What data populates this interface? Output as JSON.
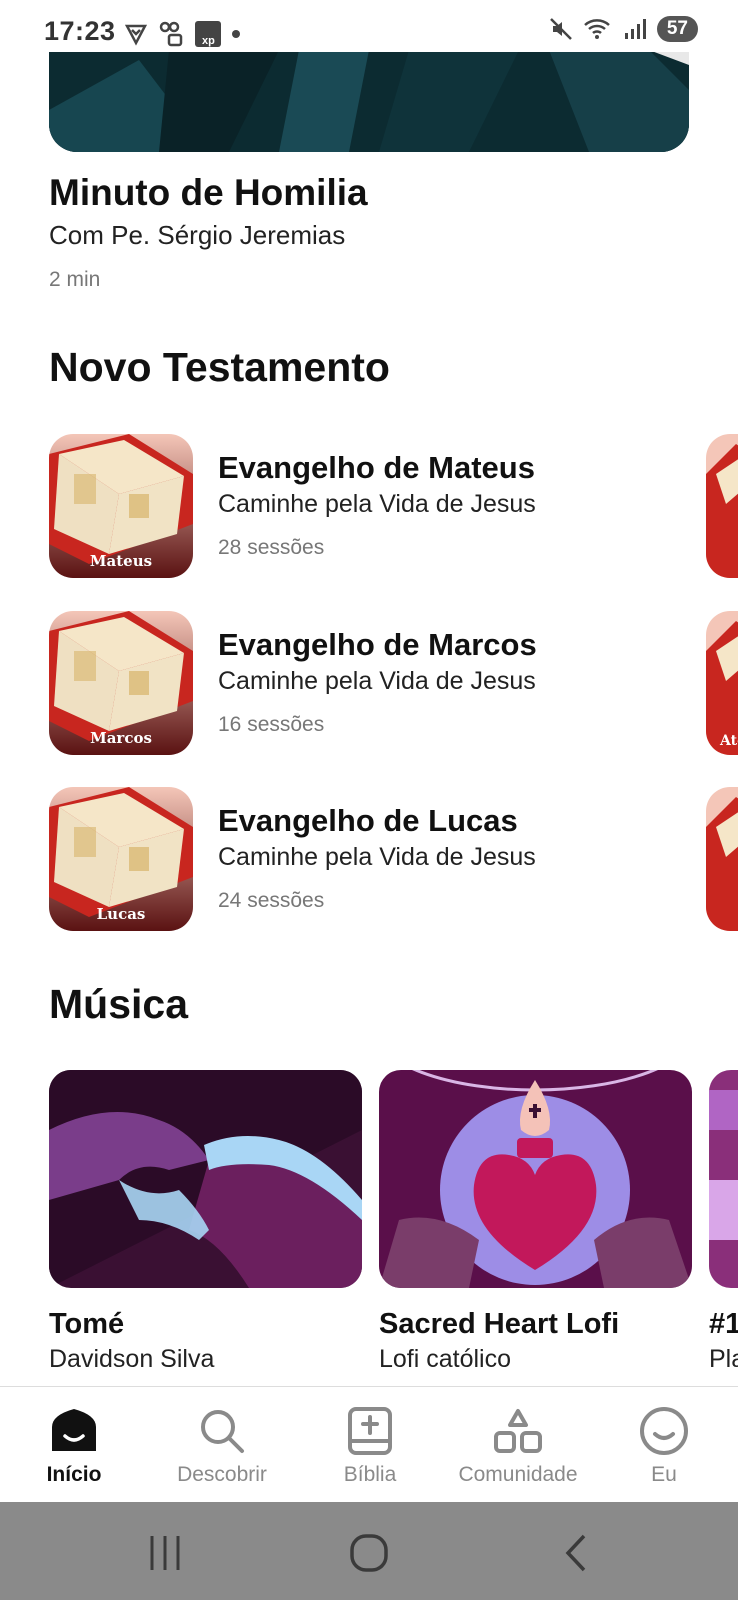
{
  "status_bar": {
    "time": "17:23",
    "battery": "57",
    "left_icons": [
      "shield-check-icon",
      "voicemail-lock-icon",
      "xp-app-icon",
      "notification-dot-icon"
    ],
    "right_icons": [
      "mute-icon",
      "wifi-6-icon",
      "signal-icon",
      "battery-icon"
    ]
  },
  "featured": {
    "title": "Minuto de Homilia",
    "subtitle": "Com Pe. Sérgio Jeremias",
    "duration": "2 min"
  },
  "novo_testamento": {
    "heading": "Novo Testamento",
    "items": [
      {
        "title": "Evangelho de Mateus",
        "subtitle": "Caminhe pela Vida de Jesus",
        "sessions": "28 sessões",
        "thumb_label": "Mateus"
      },
      {
        "title": "Evangelho de Marcos",
        "subtitle": "Caminhe pela Vida de Jesus",
        "sessions": "16 sessões",
        "thumb_label": "Marcos"
      },
      {
        "title": "Evangelho de Lucas",
        "subtitle": "Caminhe pela Vida de Jesus",
        "sessions": "24 sessões",
        "thumb_label": "Lucas"
      }
    ],
    "peek_labels": [
      "",
      "Atc",
      ""
    ]
  },
  "musica": {
    "heading": "Música",
    "items": [
      {
        "title": "Tomé",
        "subtitle": "Davidson Silva"
      },
      {
        "title": "Sacred Heart Lofi",
        "subtitle": "Lofi católico"
      },
      {
        "title": "#1",
        "subtitle": "Pla"
      }
    ]
  },
  "tabbar": {
    "items": [
      {
        "label": "Início",
        "icon": "home-smile-icon",
        "active": true
      },
      {
        "label": "Descobrir",
        "icon": "search-icon",
        "active": false
      },
      {
        "label": "Bíblia",
        "icon": "bible-cross-icon",
        "active": false
      },
      {
        "label": "Comunidade",
        "icon": "community-shapes-icon",
        "active": false
      },
      {
        "label": "Eu",
        "icon": "profile-smile-icon",
        "active": false
      }
    ]
  },
  "system_nav": {
    "buttons": [
      "recent-apps-icon",
      "home-circle-icon",
      "back-chevron-icon"
    ]
  },
  "colors": {
    "book_red": "#c8261f",
    "book_bg_pink": "#f2c2b4",
    "music_purple_dark": "#3a1033",
    "music_purple_mid": "#6b1f5e",
    "music_lavender": "#9d8de6",
    "tab_inactive": "#8a8a8a",
    "nav_bar_gray": "#8a8a8a"
  }
}
